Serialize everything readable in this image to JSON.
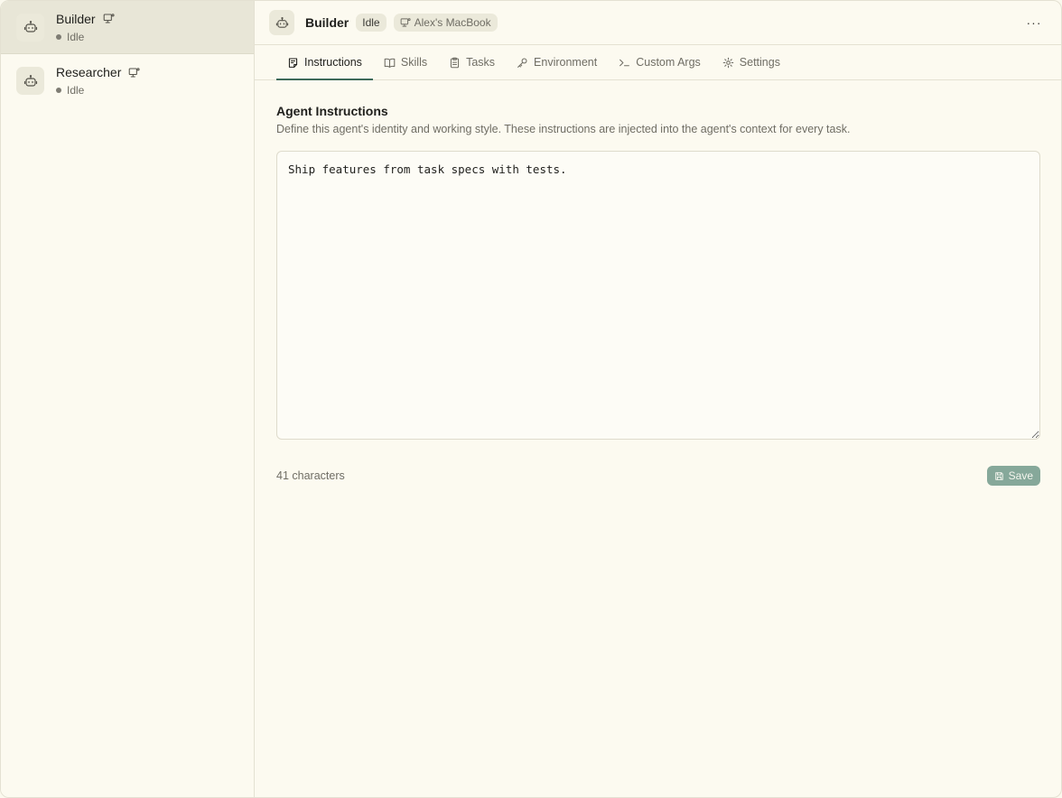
{
  "sidebar": {
    "agents": [
      {
        "name": "Builder",
        "status": "Idle",
        "icon": "bot-icon",
        "location_icon": "monitor-icon"
      },
      {
        "name": "Researcher",
        "status": "Idle",
        "icon": "bot-icon",
        "location_icon": "monitor-icon"
      }
    ]
  },
  "header": {
    "title": "Builder",
    "status_badge": "Idle",
    "machine_label": "Alex's MacBook",
    "more_label": "···"
  },
  "tabs": [
    {
      "label": "Instructions",
      "icon": "notepad-icon",
      "active": true
    },
    {
      "label": "Skills",
      "icon": "book-icon",
      "active": false
    },
    {
      "label": "Tasks",
      "icon": "clipboard-icon",
      "active": false
    },
    {
      "label": "Environment",
      "icon": "key-icon",
      "active": false
    },
    {
      "label": "Custom Args",
      "icon": "terminal-icon",
      "active": false
    },
    {
      "label": "Settings",
      "icon": "gear-icon",
      "active": false
    }
  ],
  "instructions": {
    "title": "Agent Instructions",
    "description": "Define this agent's identity and working style. These instructions are injected into the agent's context for every task.",
    "value": "Ship features from task specs with tests.",
    "char_count": "41 characters",
    "save_label": "Save"
  },
  "colors": {
    "background": "#fcfaf0",
    "accent": "#3d6a5a",
    "save_button": "#86a89a",
    "active_sidebar": "#e8e6d7"
  }
}
